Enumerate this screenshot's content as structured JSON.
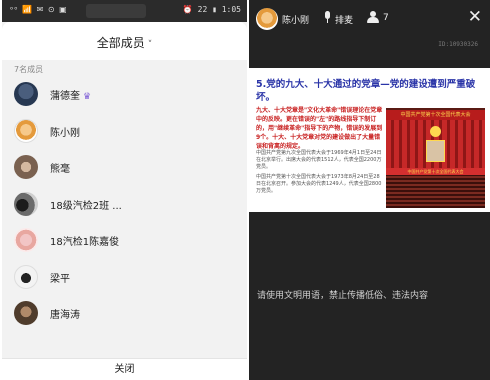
{
  "left_phone": {
    "statusbar": {
      "left_icons": "ᵒᵒ 📶 ✉ ⊙ ▣",
      "right_text": "⏰ 22 ▮ 1:05"
    },
    "sheet_title": "全部成员",
    "caret": "˅",
    "member_count_label": "7名成员",
    "members": [
      {
        "name": "蒲德奎",
        "badge": "♛"
      },
      {
        "name": "陈小刚",
        "badge": ""
      },
      {
        "name": "熊毫",
        "badge": ""
      },
      {
        "name": "18级汽检2班 ...",
        "badge": ""
      },
      {
        "name": "18汽检1陈嘉俊",
        "badge": ""
      },
      {
        "name": "梁平",
        "badge": ""
      },
      {
        "name": "唐海涛",
        "badge": ""
      }
    ],
    "close_label": "关闭"
  },
  "right_phone": {
    "user_name": "陈小刚",
    "rank_label": "排麦",
    "online_count": "7",
    "close_icon": "✕",
    "room_id": "ID:10930326",
    "slide": {
      "title": "5.党的九大、十大通过的党章—党的建设遭到严重破坏。",
      "red_text": "九大、十大党章是\"文化大革命\"错误理论在党章中的反映。更在错误的\"左\"的路线指导下制订的，用\"继续革命\"指导下的产物，错误的发展到9个。十大、十大党章对党的建设做出了大量错误和背离的规定。",
      "grey_text": [
        "中国共产党第九次全国代表大会于1969年4月1日至24日在北京举行。出席大会的代表1512人，代表全国2200万党员。",
        "中国共产党第十次全国代表大会于1973年8月24日至28日在北京召开。参加大会的代表1249人，代表全国2800万党员。"
      ],
      "photo_banner": "中国共产党第十次全国代表大会",
      "photo_banner2": "中国共产党第十次全国代表大会"
    },
    "notice": "请使用文明用语，禁止传播低俗、违法内容"
  }
}
